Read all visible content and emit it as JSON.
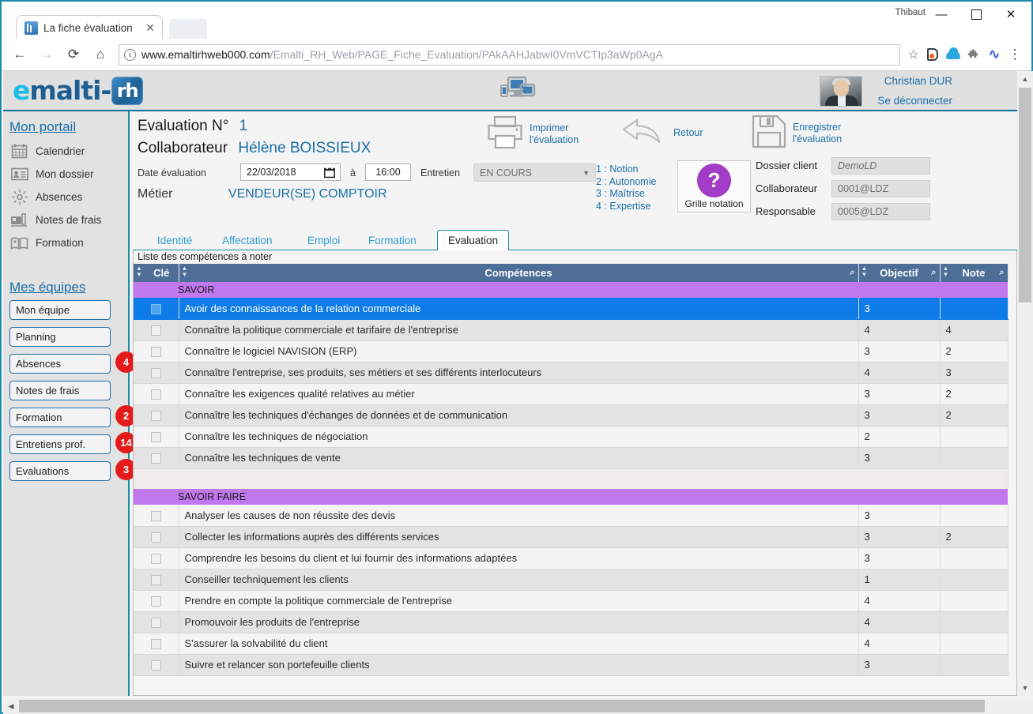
{
  "browser": {
    "tab_title": "La fiche évaluation",
    "tab_close": "✕",
    "back_icon": "←",
    "forward_icon": "→",
    "reload_icon": "⟳",
    "home_icon": "⌂",
    "info_icon": "i",
    "url_host": "www.emaltirhweb000.com",
    "url_path": "/Emalti_RH_Web/PAGE_Fiche_Evaluation/PAkAAHJabwI0VmVCTIp3aWp0AgA",
    "star_icon": "☆",
    "puzzle_icon": "✦",
    "wave_icon": "∿",
    "menu_icon": "⋮",
    "window_user": "Thibaut",
    "minimize": "—",
    "maximize": "❐",
    "close": "✕"
  },
  "app_header": {
    "logo_e": "e",
    "logo_malti": "malti",
    "logo_dash": "-",
    "logo_badge": "rh",
    "user_name": "Christian DUR",
    "logout": "Se déconnecter"
  },
  "sidebar": {
    "portal_title": "Mon portail",
    "links": [
      {
        "label": "Calendrier",
        "icon": "calendar-icon"
      },
      {
        "label": "Mon dossier",
        "icon": "id-card-icon"
      },
      {
        "label": "Absences",
        "icon": "sun-icon"
      },
      {
        "label": "Notes de frais",
        "icon": "expense-icon"
      },
      {
        "label": "Formation",
        "icon": "book-icon"
      }
    ],
    "teams_title": "Mes équipes",
    "buttons": [
      {
        "label": "Mon équipe",
        "badge": ""
      },
      {
        "label": "Planning",
        "badge": ""
      },
      {
        "label": "Absences",
        "badge": "4"
      },
      {
        "label": "Notes de frais",
        "badge": ""
      },
      {
        "label": "Formation",
        "badge": "2"
      },
      {
        "label": "Entretiens prof.",
        "badge": "14"
      },
      {
        "label": "Evaluations",
        "badge": "3"
      }
    ]
  },
  "evaluation": {
    "eval_label": "Evaluation N°",
    "eval_number": "1",
    "collab_label": "Collaborateur",
    "collab_name": "Hélène BOISSIEUX",
    "date_label": "Date évaluation",
    "date_value": "22/03/2018",
    "at_label": "à",
    "time_value": "16:00",
    "entretien_label": "Entretien",
    "entretien_value": "EN COURS",
    "entretien_caret": "▼",
    "metier_label": "Métier",
    "metier_value": "VENDEUR(SE) COMPTOIR",
    "print_label_1": "Imprimer",
    "print_label_2": "l'évaluation",
    "back_label": "Retour",
    "save_label_1": "Enregistrer",
    "save_label_2": "l'évaluation",
    "legend": [
      "1 : Notion",
      "2 : Autonomie",
      "3 : Maîtrise",
      "4 : Expertise"
    ],
    "grille_symbol": "?",
    "grille_label": "Grille notation",
    "right_fields": [
      {
        "label": "Dossier client",
        "value": "DemoLD",
        "italic": true
      },
      {
        "label": "Collaborateur",
        "value": "0001@LDZ",
        "italic": false
      },
      {
        "label": "Responsable",
        "value": "0005@LDZ",
        "italic": false
      }
    ]
  },
  "tabs": [
    {
      "label": "Identité",
      "active": false
    },
    {
      "label": "Affectation",
      "active": false
    },
    {
      "label": "Emploi",
      "active": false
    },
    {
      "label": "Formation",
      "active": false
    },
    {
      "label": "Evaluation",
      "active": true
    }
  ],
  "grid": {
    "caption": "Liste des compétences à noter",
    "columns": [
      "Clé",
      "Compétences",
      "Objectif",
      "Note"
    ],
    "sort_icon": "▲▼",
    "search_icon": "⌕",
    "rows": [
      {
        "type": "group",
        "label": "SAVOIR"
      },
      {
        "type": "row",
        "selected": true,
        "competence": "Avoir des connaissances de la relation commerciale",
        "objectif": "3",
        "note": ""
      },
      {
        "type": "row",
        "selected": false,
        "competence": "Connaître la politique commerciale et tarifaire de l'entreprise",
        "objectif": "4",
        "note": "4"
      },
      {
        "type": "row",
        "selected": false,
        "competence": "Connaître le logiciel NAVISION (ERP)",
        "objectif": "3",
        "note": "2"
      },
      {
        "type": "row",
        "selected": false,
        "competence": "Connaître l'entreprise, ses produits, ses métiers et ses différents interlocuteurs",
        "objectif": "4",
        "note": "3"
      },
      {
        "type": "row",
        "selected": false,
        "competence": "Connaître les exigences qualité relatives au métier",
        "objectif": "3",
        "note": "2"
      },
      {
        "type": "row",
        "selected": false,
        "competence": "Connaître les techniques d'échanges de données et de communication",
        "objectif": "3",
        "note": "2"
      },
      {
        "type": "row",
        "selected": false,
        "competence": "Connaître les techniques de négociation",
        "objectif": "2",
        "note": ""
      },
      {
        "type": "row",
        "selected": false,
        "competence": "Connaître les techniques de vente",
        "objectif": "3",
        "note": ""
      },
      {
        "type": "spacer"
      },
      {
        "type": "group",
        "label": "SAVOIR FAIRE"
      },
      {
        "type": "row",
        "selected": false,
        "competence": "Analyser les causes de non réussite des devis",
        "objectif": "3",
        "note": ""
      },
      {
        "type": "row",
        "selected": false,
        "competence": "Collecter les informations auprès des différents services",
        "objectif": "3",
        "note": "2"
      },
      {
        "type": "row",
        "selected": false,
        "competence": "Comprendre les besoins du client et lui fournir des informations adaptées",
        "objectif": "3",
        "note": ""
      },
      {
        "type": "row",
        "selected": false,
        "competence": "Conseiller techniquement les clients",
        "objectif": "1",
        "note": ""
      },
      {
        "type": "row",
        "selected": false,
        "competence": "Prendre en compte la politique commerciale de l'entreprise",
        "objectif": "4",
        "note": ""
      },
      {
        "type": "row",
        "selected": false,
        "competence": "Promouvoir les produits de l'entreprise",
        "objectif": "4",
        "note": ""
      },
      {
        "type": "row",
        "selected": false,
        "competence": "S'assurer la solvabilité du client",
        "objectif": "4",
        "note": ""
      },
      {
        "type": "row",
        "selected": false,
        "competence": "Suivre et relancer son portefeuille clients",
        "objectif": "3",
        "note": ""
      }
    ]
  },
  "scrollbars": {
    "up_arrow": "▲",
    "down_arrow": "▼",
    "left_arrow": "◀",
    "right_arrow": "▶"
  },
  "colors": {
    "accent_teal": "#1b8aab",
    "link_blue": "#1a6fa8",
    "group_purple": "#c178ef",
    "selection_blue": "#0e7ce8",
    "badge_red": "#e41b1b",
    "header_slate": "#4d6e96",
    "grille_purple": "#a33cc6"
  }
}
